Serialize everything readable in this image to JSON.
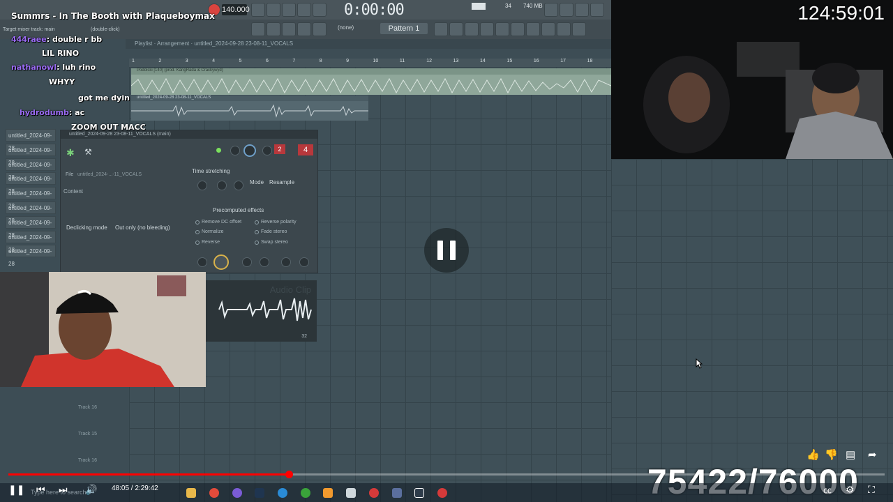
{
  "stream": {
    "title": "Summrs - In The Booth with Plaqueboymax",
    "uptime": "124:59:01",
    "counter": "75422/76000"
  },
  "fl": {
    "bpm": "140.000",
    "time": "0:00:00",
    "pattern": "Pattern 1",
    "none_label": "(none)",
    "memory": "740 MB",
    "cpu": "34",
    "mixer_hint": "Target mixer track: main",
    "double_click": "(double-click)",
    "playlist_title": "Playlist · Arrangement · untitled_2024-09-28 23-08-11_VOCALS",
    "ruler": [
      "1",
      "2",
      "3",
      "4",
      "5",
      "6",
      "7",
      "8",
      "9",
      "10",
      "11",
      "12",
      "13",
      "14",
      "15",
      "16",
      "17",
      "18"
    ],
    "clip1_label": "Podolski [140] (prod. KangRada & Crackywyd)",
    "clip2_label": "untitled_2024-09-28 23-08-11_VOCALS",
    "track_labels": [
      "Track 16",
      "Track 15",
      "Track 16"
    ]
  },
  "channels": [
    "untitled_2024-09-28 22-...",
    "untitled_2024-09-28",
    "untitled_2024-09-28",
    "untitled_2024-09-28",
    "untitled_2024-09-28",
    "untitled_2024-09-28",
    "untitled_2024-09-28",
    "untitled_2024-09-28",
    "untitled_2024-09-28",
    "untitled_2024-09-28"
  ],
  "clipwin": {
    "title": "untitled_2024-09-28 23-08-11_VOCALS (main)",
    "file_label": "File",
    "file_value": "untitled_2024-...-11_VOCALS",
    "content_label": "Content",
    "declick_label": "Declicking mode",
    "declick_value": "Out only (no bleeding)",
    "time_stretching": "Time stretching",
    "mode_label": "Mode",
    "mode_value": "Resample",
    "precomputed": "Precomputed effects",
    "fx": [
      "Remove DC offset",
      "Reverse polarity",
      "Normalize",
      "Fade stereo",
      "Reverse",
      "Swap stereo"
    ],
    "track_num": "4",
    "pitch_num": "2",
    "clip_label": "Audio Clip",
    "bottom_num": "32"
  },
  "chat": [
    {
      "user": "444raee",
      "msg": "double r bb"
    },
    {
      "user": "",
      "msg": "LIL RINO"
    },
    {
      "user": "nathanowl",
      "msg": "luh rino"
    },
    {
      "user": "",
      "msg": "WHYY"
    },
    {
      "user": "",
      "msg": "got me dyin"
    },
    {
      "user": "hydrodumb",
      "msg": "ac"
    },
    {
      "user": "",
      "msg": "ZOOM OUT MACC"
    }
  ],
  "player": {
    "current": "48:05",
    "duration": "2:29:42",
    "timecode": "48:05 / 2:29:42",
    "progress_fraction": 0.32,
    "search_placeholder": "Type here to search"
  }
}
